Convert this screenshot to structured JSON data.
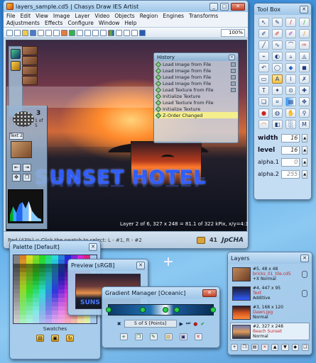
{
  "main_window": {
    "title": "layers_sample.cd5 | Chasys Draw IES Artist",
    "menu": [
      "File",
      "Edit",
      "View",
      "Image",
      "Layer",
      "Video",
      "Objects",
      "Region",
      "Engines",
      "Transforms",
      "Adjustments",
      "Effects",
      "Configure",
      "Window",
      "Help"
    ],
    "zoom": "100%",
    "canvas_text": "SUNSET HOTEL",
    "layer_status": "Layer 2 of 6, 327 x 248 = 81.1 of 322 kPix, x/y=4:3",
    "brush_number": "3",
    "brush_of": "1 of 5",
    "text_tag": "Text 2",
    "status_hint": "Red (43%) = Click the swatch to select: L - #1, R - #2",
    "status_count": "41",
    "brand": "JpCHA"
  },
  "history": {
    "title": "History",
    "items": [
      {
        "label": "Load Image from File",
        "active": false
      },
      {
        "label": "Load Image from File",
        "active": false
      },
      {
        "label": "Load Image from File",
        "active": false
      },
      {
        "label": "Load Image from File",
        "active": false
      },
      {
        "label": "Load Texture from File",
        "active": false
      },
      {
        "label": "Initialize Texture",
        "active": false
      },
      {
        "label": "Load Texture from File",
        "active": false
      },
      {
        "label": "Initialize Texture",
        "active": false
      },
      {
        "label": "Z-Order Changed",
        "active": true
      }
    ]
  },
  "toolbox": {
    "title": "Tool Box",
    "width_label": "width",
    "width_value": "16",
    "level_label": "level",
    "level_value": "16",
    "alpha1_label": "alpha.1",
    "alpha1_value": "0",
    "alpha2_label": "alpha.2",
    "alpha2_value": "255"
  },
  "palette": {
    "title": "Palette [Default]",
    "swatches_label": "Swatches"
  },
  "preview": {
    "title": "Preview [sRGB]",
    "image_text": "SUNS"
  },
  "gradient": {
    "title": "Gradient Manager [Oceanic]",
    "points": "5 of 5 [Points]"
  },
  "layers": {
    "title": "Layers",
    "items": [
      {
        "dims": "#5, 48 x 48",
        "name": "bricks_01_tile.cd5",
        "blend": "+X Normal",
        "selected": false,
        "thumb": "linear-gradient(135deg,#c28a5a,#6b3b22)"
      },
      {
        "dims": "#4, 447 x 95",
        "name": "Text",
        "blend": "Additive",
        "selected": false,
        "thumb": "linear-gradient(#1a1a2a,#2f5dff)"
      },
      {
        "dims": "#3, 168 x 120",
        "name": "Dawn.jpg",
        "blend": "Normal",
        "selected": false,
        "thumb": "linear-gradient(#2a1a22,#d0521e,#ff8c3a)"
      },
      {
        "dims": "#2, 327 x 248",
        "name": "Beach Sunset",
        "blend": "Normal",
        "selected": true,
        "thumb": "linear-gradient(#6a7ab0,#e09a5a,#2a3048)"
      }
    ]
  }
}
